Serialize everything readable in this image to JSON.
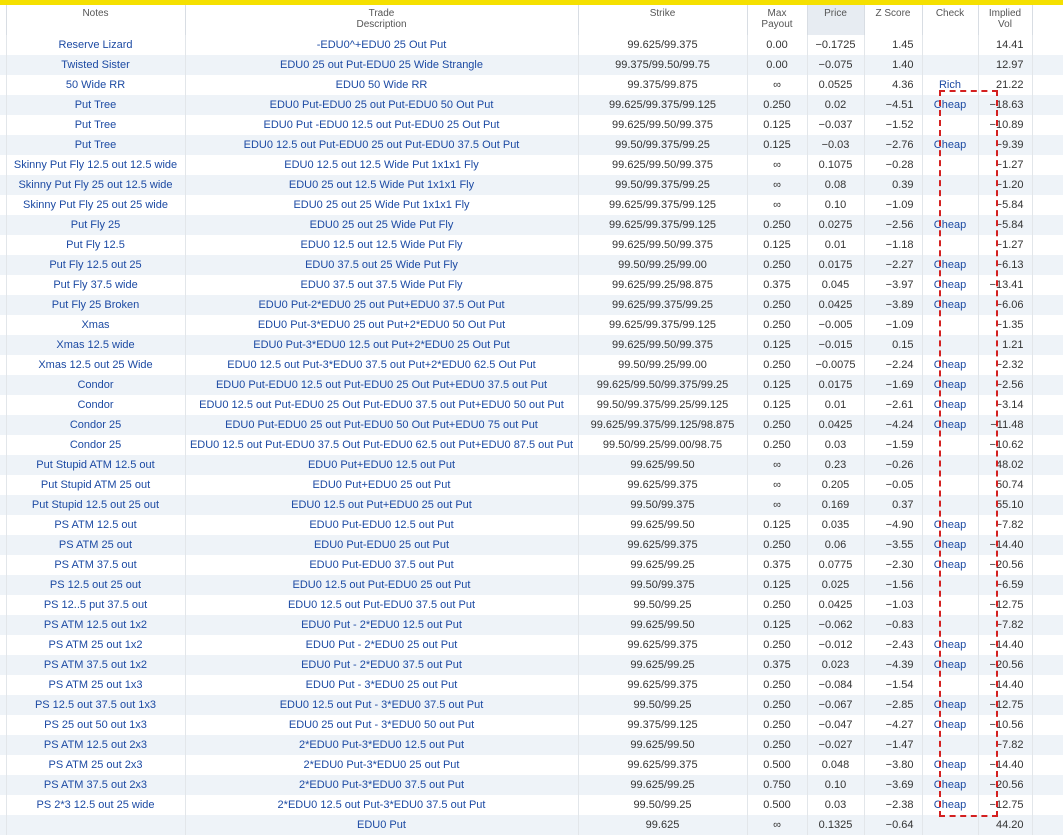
{
  "headers": {
    "notes": "Notes",
    "trade_line1": "Trade",
    "trade_line2": "Description",
    "strike": "Strike",
    "max_line1": "Max",
    "max_line2": "Payout",
    "price": "Price",
    "z": "Z Score",
    "check": "Check",
    "vol_line1": "Implied",
    "vol_line2": "Vol"
  },
  "rows": [
    [
      "Reserve Lizard",
      "-EDU0^+EDU0 25 Out Put",
      "99.625/99.375",
      "0.00",
      "−0.1725",
      "1.45",
      "",
      "14.41"
    ],
    [
      "Twisted Sister",
      "EDU0 25 out Put-EDU0 25 Wide Strangle",
      "99.375/99.50/99.75",
      "0.00",
      "−0.075",
      "1.40",
      "",
      "12.97"
    ],
    [
      "50 Wide RR",
      "EDU0 50 Wide RR",
      "99.375/99.875",
      "∞",
      "0.0525",
      "4.36",
      "Rich",
      "21.22"
    ],
    [
      "Put Tree",
      "EDU0 Put-EDU0 25 out Put-EDU0 50 Out Put",
      "99.625/99.375/99.125",
      "0.250",
      "0.02",
      "−4.51",
      "Cheap",
      "−18.63"
    ],
    [
      "Put Tree",
      "EDU0 Put -EDU0 12.5 out Put-EDU0 25 Out Put",
      "99.625/99.50/99.375",
      "0.125",
      "−0.037",
      "−1.52",
      "",
      "−10.89"
    ],
    [
      "Put Tree",
      "EDU0 12.5 out Put-EDU0 25 out Put-EDU0 37.5 Out Put",
      "99.50/99.375/99.25",
      "0.125",
      "−0.03",
      "−2.76",
      "Cheap",
      "−9.39"
    ],
    [
      "Skinny Put Fly 12.5 out 12.5 wide",
      "EDU0 12.5 out 12.5 Wide Put 1x1x1 Fly",
      "99.625/99.50/99.375",
      "∞",
      "0.1075",
      "−0.28",
      "",
      "−1.27"
    ],
    [
      "Skinny Put Fly 25 out 12.5 wide",
      "EDU0 25 out 12.5 Wide Put 1x1x1 Fly",
      "99.50/99.375/99.25",
      "∞",
      "0.08",
      "0.39",
      "",
      "−1.20"
    ],
    [
      "Skinny Put Fly 25 out 25 wide",
      "EDU0 25 out 25 Wide Put 1x1x1 Fly",
      "99.625/99.375/99.125",
      "∞",
      "0.10",
      "−1.09",
      "",
      "−5.84"
    ],
    [
      "Put Fly 25",
      "EDU0 25 out 25 Wide Put Fly",
      "99.625/99.375/99.125",
      "0.250",
      "0.0275",
      "−2.56",
      "Cheap",
      "−5.84"
    ],
    [
      "Put Fly 12.5",
      "EDU0 12.5 out 12.5 Wide Put Fly",
      "99.625/99.50/99.375",
      "0.125",
      "0.01",
      "−1.18",
      "",
      "−1.27"
    ],
    [
      "Put Fly 12.5 out 25",
      "EDU0 37.5 out 25 Wide Put Fly",
      "99.50/99.25/99.00",
      "0.250",
      "0.0175",
      "−2.27",
      "Cheap",
      "−6.13"
    ],
    [
      "Put Fly 37.5 wide",
      "EDU0 37.5 out 37.5 Wide Put Fly",
      "99.625/99.25/98.875",
      "0.375",
      "0.045",
      "−3.97",
      "Cheap",
      "−13.41"
    ],
    [
      "Put Fly 25 Broken",
      "EDU0 Put-2*EDU0 25 out Put+EDU0 37.5 Out Put",
      "99.625/99.375/99.25",
      "0.250",
      "0.0425",
      "−3.89",
      "Cheap",
      "−6.06"
    ],
    [
      "Xmas",
      "EDU0 Put-3*EDU0 25 out Put+2*EDU0 50 Out Put",
      "99.625/99.375/99.125",
      "0.250",
      "−0.005",
      "−1.09",
      "",
      "−1.35"
    ],
    [
      "Xmas 12.5 wide",
      "EDU0 Put-3*EDU0 12.5 out Put+2*EDU0 25 Out Put",
      "99.625/99.50/99.375",
      "0.125",
      "−0.015",
      "0.15",
      "",
      "1.21"
    ],
    [
      "Xmas 12.5 out 25 Wide",
      "EDU0 12.5 out Put-3*EDU0 37.5 out Put+2*EDU0 62.5 Out Put",
      "99.50/99.25/99.00",
      "0.250",
      "−0.0075",
      "−2.24",
      "Cheap",
      "−2.32"
    ],
    [
      "Condor",
      "EDU0 Put-EDU0 12.5 out Put-EDU0 25 Out Put+EDU0 37.5 out Put",
      "99.625/99.50/99.375/99.25",
      "0.125",
      "0.0175",
      "−1.69",
      "Cheap",
      "−2.56"
    ],
    [
      "Condor",
      "EDU0 12.5 out Put-EDU0 25 Out Put-EDU0 37.5 out Put+EDU0 50 out Put",
      "99.50/99.375/99.25/99.125",
      "0.125",
      "0.01",
      "−2.61",
      "Cheap",
      "−3.14"
    ],
    [
      "Condor 25",
      "EDU0 Put-EDU0 25 out Put-EDU0 50 Out Put+EDU0 75 out Put",
      "99.625/99.375/99.125/98.875",
      "0.250",
      "0.0425",
      "−4.24",
      "Cheap",
      "−11.48"
    ],
    [
      "Condor 25",
      "EDU0 12.5 out Put-EDU0 37.5 Out Put-EDU0 62.5 out Put+EDU0 87.5 out Put",
      "99.50/99.25/99.00/98.75",
      "0.250",
      "0.03",
      "−1.59",
      "",
      "−10.62"
    ],
    [
      "Put Stupid ATM 12.5 out",
      "EDU0 Put+EDU0 12.5 out Put",
      "99.625/99.50",
      "∞",
      "0.23",
      "−0.26",
      "",
      "48.02"
    ],
    [
      "Put Stupid ATM 25 out",
      "EDU0 Put+EDU0 25 out Put",
      "99.625/99.375",
      "∞",
      "0.205",
      "−0.05",
      "",
      "50.74"
    ],
    [
      "Put Stupid 12.5 out 25 out",
      "EDU0 12.5 out Put+EDU0 25 out Put",
      "99.50/99.375",
      "∞",
      "0.169",
      "0.37",
      "",
      "55.10"
    ],
    [
      "PS ATM 12.5 out",
      "EDU0 Put-EDU0 12.5 out Put",
      "99.625/99.50",
      "0.125",
      "0.035",
      "−4.90",
      "Cheap",
      "−7.82"
    ],
    [
      "PS ATM 25 out",
      "EDU0 Put-EDU0 25 out Put",
      "99.625/99.375",
      "0.250",
      "0.06",
      "−3.55",
      "Cheap",
      "−14.40"
    ],
    [
      "PS ATM 37.5 out",
      "EDU0 Put-EDU0 37.5 out Put",
      "99.625/99.25",
      "0.375",
      "0.0775",
      "−2.30",
      "Cheap",
      "−20.56"
    ],
    [
      "PS 12.5 out 25 out",
      "EDU0 12.5 out Put-EDU0 25 out Put",
      "99.50/99.375",
      "0.125",
      "0.025",
      "−1.56",
      "",
      "−6.59"
    ],
    [
      "PS 12..5 put 37.5 out",
      "EDU0 12.5 out Put-EDU0 37.5 out Put",
      "99.50/99.25",
      "0.250",
      "0.0425",
      "−1.03",
      "",
      "−12.75"
    ],
    [
      "PS ATM 12.5 out 1x2",
      "EDU0 Put - 2*EDU0 12.5 out Put",
      "99.625/99.50",
      "0.125",
      "−0.062",
      "−0.83",
      "",
      "−7.82"
    ],
    [
      "PS ATM 25 out 1x2",
      "EDU0 Put - 2*EDU0 25 out Put",
      "99.625/99.375",
      "0.250",
      "−0.012",
      "−2.43",
      "Cheap",
      "−14.40"
    ],
    [
      "PS ATM 37.5 out 1x2",
      "EDU0 Put - 2*EDU0 37.5 out Put",
      "99.625/99.25",
      "0.375",
      "0.023",
      "−4.39",
      "Cheap",
      "−20.56"
    ],
    [
      "PS ATM 25 out 1x3",
      "EDU0 Put - 3*EDU0 25 out Put",
      "99.625/99.375",
      "0.250",
      "−0.084",
      "−1.54",
      "",
      "−14.40"
    ],
    [
      "PS 12.5 out 37.5 out 1x3",
      "EDU0 12.5 out Put - 3*EDU0 37.5 out Put",
      "99.50/99.25",
      "0.250",
      "−0.067",
      "−2.85",
      "Cheap",
      "−12.75"
    ],
    [
      "PS 25 out 50 out 1x3",
      "EDU0 25 out Put - 3*EDU0 50 out Put",
      "99.375/99.125",
      "0.250",
      "−0.047",
      "−4.27",
      "Cheap",
      "−10.56"
    ],
    [
      "PS ATM 12.5 out 2x3",
      "2*EDU0 Put-3*EDU0 12.5 out Put",
      "99.625/99.50",
      "0.250",
      "−0.027",
      "−1.47",
      "",
      "−7.82"
    ],
    [
      "PS ATM 25 out 2x3",
      "2*EDU0 Put-3*EDU0 25 out Put",
      "99.625/99.375",
      "0.500",
      "0.048",
      "−3.80",
      "Cheap",
      "−14.40"
    ],
    [
      "PS ATM 37.5 out 2x3",
      "2*EDU0 Put-3*EDU0 37.5 out Put",
      "99.625/99.25",
      "0.750",
      "0.10",
      "−3.69",
      "Cheap",
      "−20.56"
    ],
    [
      "PS 2*3 12.5 out 25 wide",
      "2*EDU0 12.5 out Put-3*EDU0 37.5 out Put",
      "99.50/99.25",
      "0.500",
      "0.03",
      "−2.38",
      "Cheap",
      "−12.75"
    ],
    [
      "",
      "EDU0 Put",
      "99.625",
      "∞",
      "0.1325",
      "−0.64",
      "",
      "44.20"
    ]
  ],
  "colors": {
    "accent_bar": "#f5e000",
    "highlight_box": "#d42020",
    "link_text": "#1c4aa3"
  }
}
